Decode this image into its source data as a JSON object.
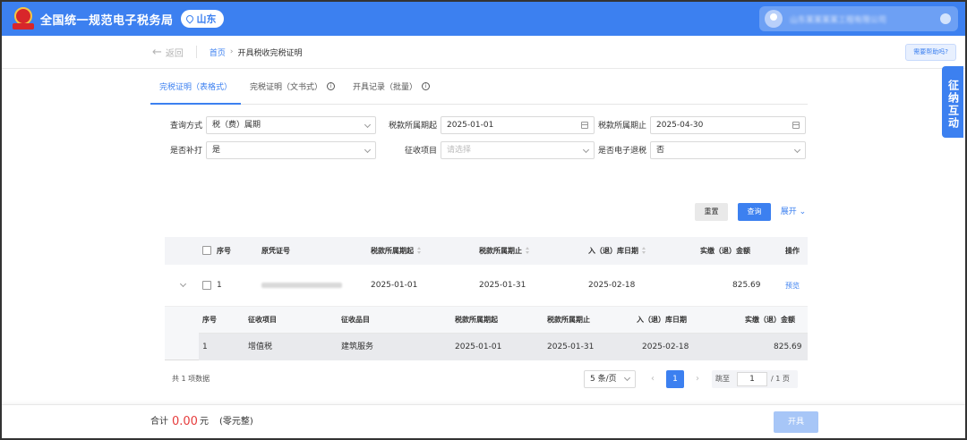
{
  "header": {
    "site_title": "全国统一规范电子税务局",
    "region": "山东",
    "user_name": "山东某某某某工程有限公司"
  },
  "nav": {
    "back": "返回",
    "home": "首页",
    "separator": "›",
    "current": "开具税收完税证明",
    "help": "需要帮助吗?"
  },
  "tabs": [
    {
      "label": "完税证明（表格式）",
      "active": true
    },
    {
      "label": "完税证明（文书式）",
      "info": true
    },
    {
      "label": "开具记录（批量）",
      "info": true
    }
  ],
  "form": {
    "query_mode": {
      "label": "查询方式",
      "value": "税（费）属期"
    },
    "tax_period_start": {
      "label": "税款所属期起",
      "value": "2025-01-01"
    },
    "tax_period_end": {
      "label": "税款所属期止",
      "value": "2025-04-30"
    },
    "reprint": {
      "label": "是否补打",
      "value": "是"
    },
    "levy_item": {
      "label": "征收项目",
      "placeholder": "请选择"
    },
    "e_refund": {
      "label": "是否电子退税",
      "value": "否"
    }
  },
  "actions": {
    "reset": "重置",
    "query": "查询",
    "expand": "展开"
  },
  "table": {
    "headers": [
      "序号",
      "原凭证号",
      "税款所属期起",
      "税款所属期止",
      "入（退）库日期",
      "实缴（退）金额",
      "操作"
    ],
    "rows": [
      {
        "index": "1",
        "voucher": "3XXXXXXXXXXXXXXXXX",
        "start": "2025-01-01",
        "end": "2025-01-31",
        "date": "2025-02-18",
        "amount": "825.69",
        "action": "预览"
      }
    ]
  },
  "subtable": {
    "headers": [
      "序号",
      "征收项目",
      "征收品目",
      "税款所属期起",
      "税款所属期止",
      "入（退）库日期",
      "实缴（退）金额"
    ],
    "rows": [
      {
        "index": "1",
        "item": "增值税",
        "category": "建筑服务",
        "start": "2025-01-01",
        "end": "2025-01-31",
        "date": "2025-02-18",
        "amount": "825.69"
      }
    ]
  },
  "pagination": {
    "total": "共 1 项数据",
    "page_size": "5 条/页",
    "prev": "‹",
    "next": "›",
    "current_page": "1",
    "jump_label": "跳至",
    "jump_value": "1",
    "total_pages": "/ 1 页"
  },
  "side_float": "征纳互动",
  "bottom": {
    "sum_label": "合计",
    "sum_amount": "0.00",
    "sum_unit": "元",
    "sum_words": "(零元整)",
    "issue_button": "开具"
  },
  "colors": {
    "primary": "#3c80f0",
    "amount_red": "#e63c3c",
    "disabled_button": "#a7c6f7"
  }
}
